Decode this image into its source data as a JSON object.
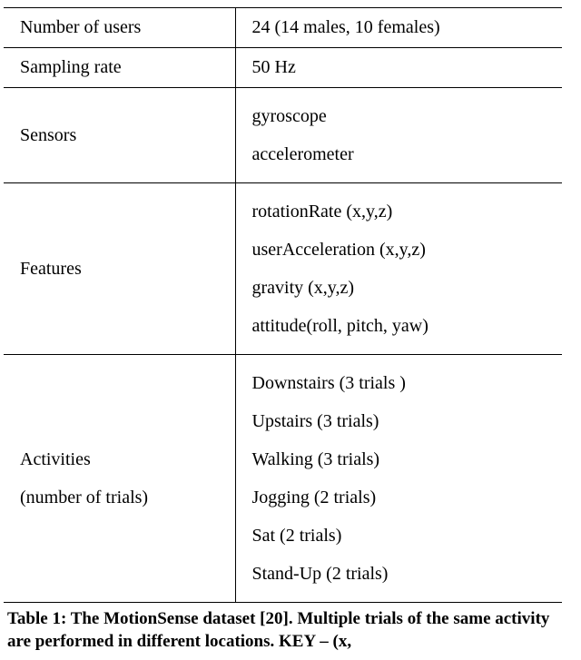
{
  "chart_data": {
    "type": "table",
    "rows": [
      {
        "label": "Number of users",
        "value": "24 (14 males, 10 females)"
      },
      {
        "label": "Sampling rate",
        "value": "50 Hz"
      },
      {
        "label": "Sensors",
        "value_lines": [
          "gyroscope",
          "accelerometer"
        ]
      },
      {
        "label": "Features",
        "value_lines": [
          "rotationRate (x,y,z)",
          "userAcceleration (x,y,z)",
          "gravity (x,y,z)",
          "attitude(roll, pitch, yaw)"
        ]
      },
      {
        "label_lines": [
          "Activities",
          "(number of trials)"
        ],
        "value_lines": [
          "Downstairs (3 trials )",
          "Upstairs (3 trials)",
          "Walking (3 trials)",
          "Jogging (2 trials)",
          "Sat (2 trials)",
          "Stand-Up (2 trials)"
        ]
      }
    ]
  },
  "caption": "Table 1: The MotionSense dataset [20]. Multiple trials of the same activity are performed in different locations. KEY – (x,"
}
